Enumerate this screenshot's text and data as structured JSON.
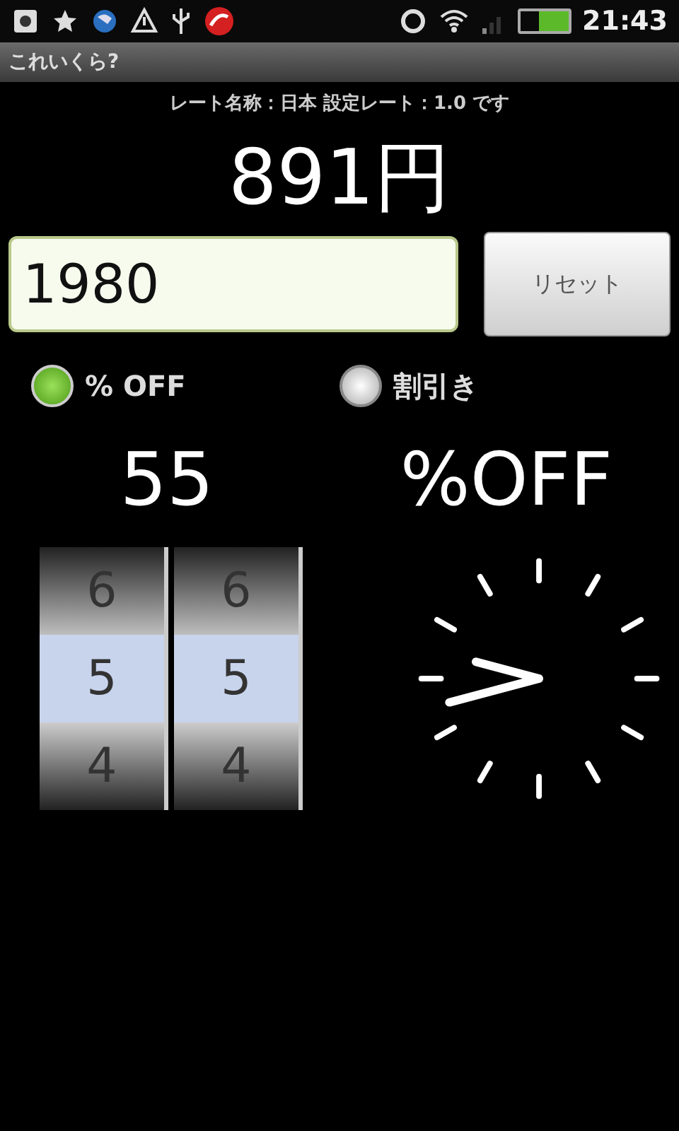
{
  "status_bar": {
    "time": "21:43",
    "battery": {
      "level": 0.6
    }
  },
  "window": {
    "title": "これいくら?"
  },
  "info": "レート名称：日本 設定レート：1.0 です",
  "result": "891円",
  "price_field": {
    "value": "1980"
  },
  "reset_button": "リセット",
  "modes": [
    {
      "label": "% OFF",
      "selected": true
    },
    {
      "label": "割引き",
      "selected": false
    }
  ],
  "discount_value": "55",
  "discount_unit": "%OFF",
  "wheels": [
    {
      "items": [
        {
          "label": "6",
          "selected": false
        },
        {
          "label": "5",
          "selected": true
        },
        {
          "label": "4",
          "selected": false
        }
      ]
    },
    {
      "items": [
        {
          "label": "6",
          "selected": false
        },
        {
          "label": "5",
          "selected": true
        },
        {
          "label": "4",
          "selected": false
        }
      ]
    }
  ]
}
